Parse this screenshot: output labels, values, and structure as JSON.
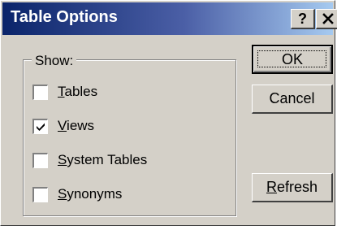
{
  "window": {
    "title": "Table Options",
    "help_label": "?"
  },
  "group": {
    "label": "Show:",
    "items": [
      {
        "label": "Tables",
        "accel": "T",
        "rest": "ables",
        "checked": false
      },
      {
        "label": "Views",
        "accel": "V",
        "rest": "iews",
        "checked": true
      },
      {
        "label": "System Tables",
        "accel": "S",
        "rest": "ystem Tables",
        "checked": false
      },
      {
        "label": "Synonyms",
        "accel": "S",
        "rest": "ynonyms",
        "checked": false
      }
    ]
  },
  "buttons": {
    "ok": "OK",
    "cancel": "Cancel",
    "refresh_accel": "R",
    "refresh_rest": "efresh"
  }
}
